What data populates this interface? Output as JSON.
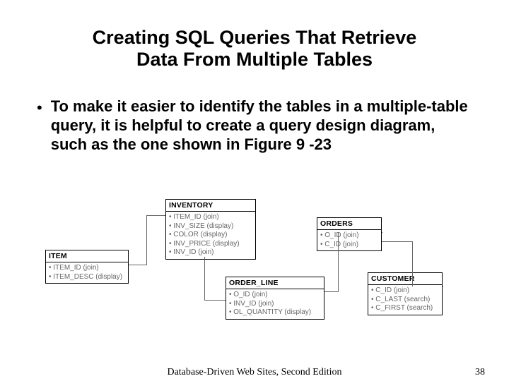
{
  "title_line1": "Creating SQL Queries That Retrieve",
  "title_line2": "Data From Multiple Tables",
  "bullet": "To make it easier to identify the tables in a multiple-table query, it is helpful to create a query design diagram, such as the one shown in Figure 9 -23",
  "boxes": {
    "item": {
      "title": "ITEM",
      "rows": [
        "• ITEM_ID (join)",
        "• ITEM_DESC (display)"
      ]
    },
    "inventory": {
      "title": "INVENTORY",
      "rows": [
        "• ITEM_ID (join)",
        "• INV_SIZE (display)",
        "• COLOR (display)",
        "• INV_PRICE (display)",
        "• INV_ID (join)"
      ]
    },
    "orders": {
      "title": "ORDERS",
      "rows": [
        "• O_ID (join)",
        "• C_ID (join)"
      ]
    },
    "order_line": {
      "title": "ORDER_LINE",
      "rows": [
        "• O_ID (join)",
        "• INV_ID (join)",
        "• OL_QUANTITY (display)"
      ]
    },
    "customer": {
      "title": "CUSTOMER",
      "rows": [
        "• C_ID (join)",
        "• C_LAST (search)",
        "• C_FIRST (search)"
      ]
    }
  },
  "footer_center": "Database-Driven Web Sites, Second Edition",
  "footer_page": "38"
}
